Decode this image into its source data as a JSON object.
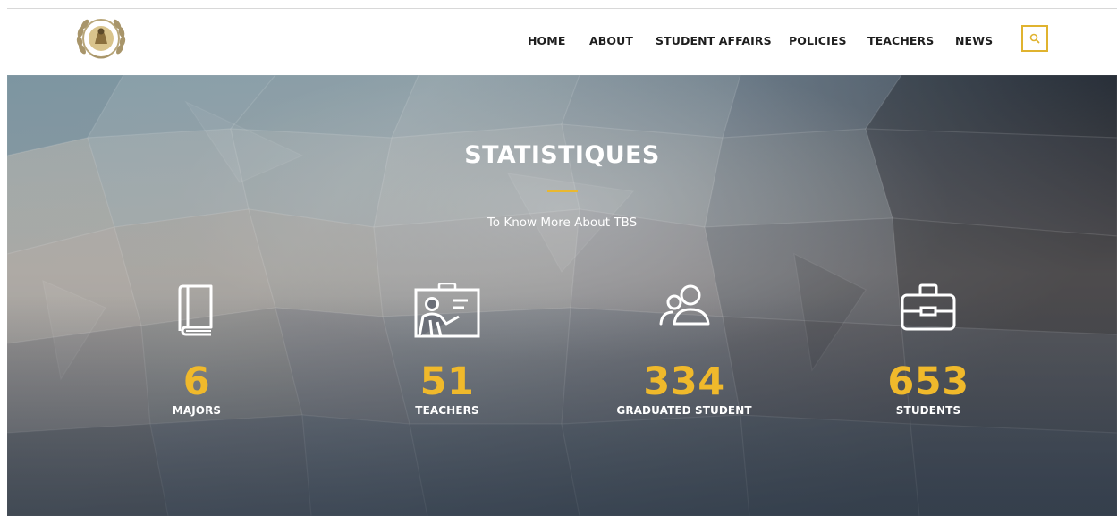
{
  "header": {
    "logo_icon": "eagle-laurel-emblem-icon",
    "nav": [
      "HOME",
      "ABOUT",
      "STUDENT AFFAIRS",
      "POLICIES",
      "TEACHERS",
      "NEWS"
    ],
    "search_icon": "search-icon",
    "accent_color": "#e0b32f"
  },
  "hero": {
    "title": "STATISTIQUES",
    "subtitle": "To Know More About TBS",
    "divider_color": "#e9b830",
    "stats": [
      {
        "icon": "book-icon",
        "value": "6",
        "label": "MAJORS"
      },
      {
        "icon": "teacher-whiteboard-icon",
        "value": "51",
        "label": "TEACHERS"
      },
      {
        "icon": "users-icon",
        "value": "334",
        "label": "GRADUATED STUDENT"
      },
      {
        "icon": "briefcase-icon",
        "value": "653",
        "label": "STUDENTS"
      }
    ],
    "number_color": "#f0b92b"
  }
}
